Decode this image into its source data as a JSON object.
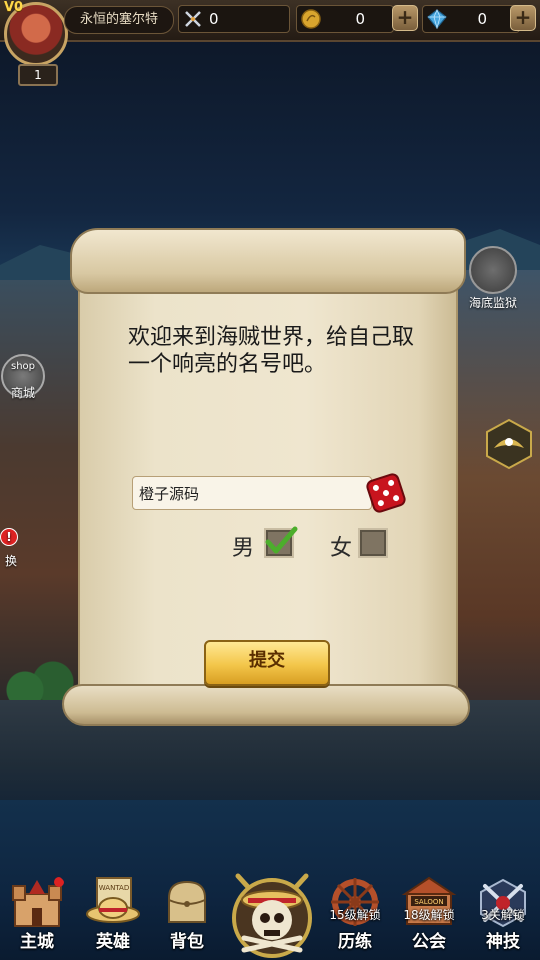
{
  "topbar": {
    "vip": "V0",
    "level": "1",
    "player_name": "永恒的塞尔特",
    "power": "0",
    "gold": "0",
    "diamond": "0",
    "plus": "+"
  },
  "side": {
    "prison": "海底监狱",
    "shop_top": "shop",
    "shop": "商城",
    "alert": "!",
    "left_partial": "换"
  },
  "dialog": {
    "message": "欢迎来到海贼世界，给自己取一个响亮的名号吧。",
    "name_value": "橙子源码",
    "male": "男",
    "female": "女",
    "male_checked": true,
    "female_checked": false,
    "submit": "提交"
  },
  "nav": {
    "items": [
      {
        "label": "主城"
      },
      {
        "label": "英雄"
      },
      {
        "label": "背包"
      },
      {
        "label": "历练",
        "lock": "15级解锁"
      },
      {
        "label": "公会",
        "lock": "18级解锁"
      },
      {
        "label": "神技",
        "lock": "3关解锁"
      }
    ],
    "wanted": "WANTAD",
    "saloon": "SALOON"
  },
  "colors": {
    "gold_button": "#f3c64a",
    "parchment": "#efe6cf",
    "check_green": "#4cae2c"
  }
}
